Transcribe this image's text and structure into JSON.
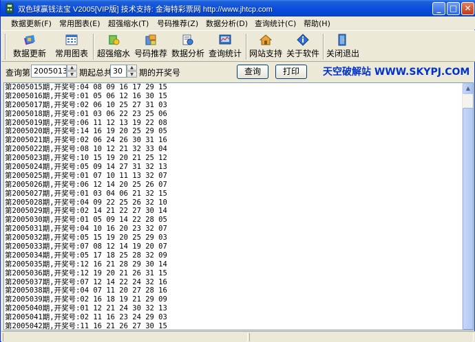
{
  "window": {
    "title": "双色球赢钱法宝  V2005[VIP版]  技术支持: 金海特彩票网  http://www.jhtcp.com",
    "controls": {
      "minimize": "_",
      "maximize": "□",
      "close": "✕"
    }
  },
  "menu": [
    {
      "label": "数据更新(F)"
    },
    {
      "label": "常用图表(E)"
    },
    {
      "label": "超强缩水(T)"
    },
    {
      "label": "号码推荐(Z)"
    },
    {
      "label": "数据分析(D)"
    },
    {
      "label": "查询统计(C)"
    },
    {
      "label": "帮助(H)"
    }
  ],
  "toolbar": [
    {
      "label": "数据更新",
      "icon": "data-update-icon"
    },
    {
      "label": "常用图表",
      "icon": "chart-icon"
    },
    {
      "label": "超强缩水",
      "icon": "filter-icon"
    },
    {
      "label": "号码推荐",
      "icon": "recommend-icon"
    },
    {
      "label": "数据分析",
      "icon": "analysis-icon"
    },
    {
      "label": "查询统计",
      "icon": "statistics-icon"
    },
    {
      "label": "网站支持",
      "icon": "website-icon"
    },
    {
      "label": "关于软件",
      "icon": "about-icon"
    },
    {
      "label": "关闭退出",
      "icon": "exit-icon"
    }
  ],
  "query": {
    "prefix": "查询第",
    "issue_value": "2005013",
    "middle": "期起总共",
    "count_value": "30",
    "suffix": "期的开奖号",
    "search_label": "查询",
    "print_label": "打印",
    "banner": "天空破解站  WWW.SKYPJ.COM"
  },
  "results": [
    "第2005015期,开奖号:04 08 09 16 17 29 15",
    "第2005016期,开奖号:01 05 06 12 16 30 15",
    "第2005017期,开奖号:02 06 10 25 27 31 03",
    "第2005018期,开奖号:01 03 06 22 23 25 06",
    "第2005019期,开奖号:06 11 12 13 19 22 08",
    "第2005020期,开奖号:14 16 19 20 25 29 05",
    "第2005021期,开奖号:02 06 24 26 30 31 16",
    "第2005022期,开奖号:08 10 12 21 32 33 04",
    "第2005023期,开奖号:10 15 19 20 21 25 12",
    "第2005024期,开奖号:05 09 14 27 31 32 13",
    "第2005025期,开奖号:01 07 10 11 13 32 07",
    "第2005026期,开奖号:06 12 14 20 25 26 07",
    "第2005027期,开奖号:01 03 04 06 21 32 15",
    "第2005028期,开奖号:04 09 22 25 26 32 10",
    "第2005029期,开奖号:02 14 21 22 27 30 14",
    "第2005030期,开奖号:01 05 09 14 22 28 05",
    "第2005031期,开奖号:04 10 16 20 23 32 07",
    "第2005032期,开奖号:05 15 19 20 25 29 03",
    "第2005033期,开奖号:07 08 12 14 19 20 07",
    "第2005034期,开奖号:05 17 18 25 28 32 09",
    "第2005035期,开奖号:12 16 21 28 29 30 14",
    "第2005036期,开奖号:12 19 20 21 26 31 15",
    "第2005037期,开奖号:07 12 14 22 24 32 16",
    "第2005038期,开奖号:04 07 11 20 27 28 16",
    "第2005039期,开奖号:02 16 18 19 21 29 09",
    "第2005040期,开奖号:01 12 21 24 30 32 13",
    "第2005041期,开奖号:02 11 16 23 24 29 03",
    "第2005042期,开奖号:11 16 21 26 27 30 15"
  ],
  "colors": {
    "titlebar": "#0a4ee0",
    "face": "#ece9d8",
    "banner_text": "#0033cc"
  }
}
